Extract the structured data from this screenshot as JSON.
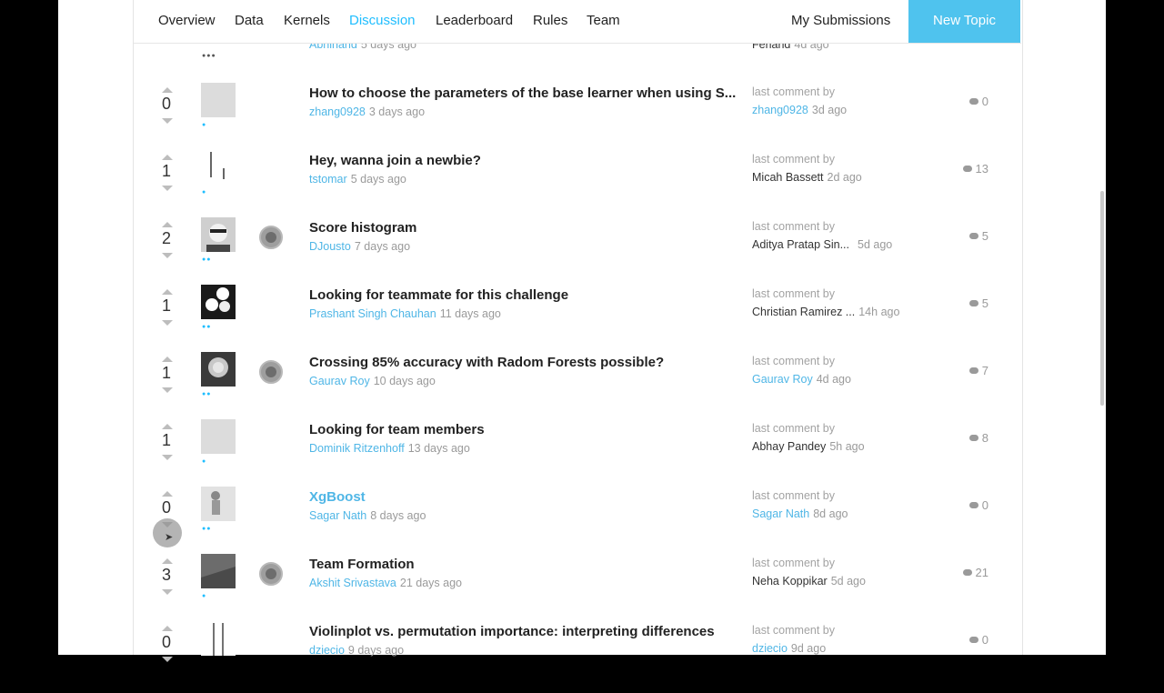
{
  "nav": {
    "items": [
      "Overview",
      "Data",
      "Kernels",
      "Discussion",
      "Leaderboard",
      "Rules",
      "Team"
    ],
    "active": "Discussion",
    "my_submissions": "My Submissions",
    "new_topic": "New Topic"
  },
  "partial_row": {
    "author": "Abhinand",
    "ago": "5 days ago",
    "last_commenter": "Ferland",
    "last_ago": "4d ago"
  },
  "last_comment_label": "last comment by",
  "topics": [
    {
      "votes": "0",
      "title": "How to choose the parameters of the base learner when using S...",
      "author": "zhang0928",
      "ago": "3 days ago",
      "last_commenter": "zhang0928",
      "last_ago": "3d ago",
      "comments": "0"
    },
    {
      "votes": "1",
      "title": "Hey, wanna join a newbie?",
      "author": "tstomar",
      "ago": "5 days ago",
      "last_commenter": "Micah Bassett",
      "last_ago": "2d ago",
      "comments": "13"
    },
    {
      "votes": "2",
      "title": "Score histogram",
      "author": "DJousto",
      "ago": "7 days ago",
      "last_commenter": "Aditya Pratap Sin...",
      "last_ago": "5d ago",
      "comments": "5"
    },
    {
      "votes": "1",
      "title": "Looking for teammate for this challenge",
      "author": "Prashant Singh Chauhan",
      "ago": "11 days ago",
      "last_commenter": "Christian Ramirez ...",
      "last_ago": "14h ago",
      "comments": "5"
    },
    {
      "votes": "1",
      "title": "Crossing 85% accuracy with Radom Forests possible?",
      "author": "Gaurav Roy",
      "ago": "10 days ago",
      "last_commenter": "Gaurav Roy",
      "last_ago": "4d ago",
      "comments": "7"
    },
    {
      "votes": "1",
      "title": "Looking for team members",
      "author": "Dominik Ritzenhoff",
      "ago": "13 days ago",
      "last_commenter": "Abhay Pandey",
      "last_ago": "5h ago",
      "comments": "8"
    },
    {
      "votes": "0",
      "title": "XgBoost",
      "author": "Sagar Nath",
      "ago": "8 days ago",
      "last_commenter": "Sagar Nath",
      "last_ago": "8d ago",
      "comments": "0"
    },
    {
      "votes": "3",
      "title": "Team Formation",
      "author": "Akshit Srivastava",
      "ago": "21 days ago",
      "last_commenter": "Neha Koppikar",
      "last_ago": "5d ago",
      "comments": "21"
    },
    {
      "votes": "0",
      "title": "Violinplot vs. permutation importance: interpreting differences",
      "author": "dziecio",
      "ago": "9 days ago",
      "last_commenter": "dziecio",
      "last_ago": "9d ago",
      "comments": "0"
    }
  ]
}
